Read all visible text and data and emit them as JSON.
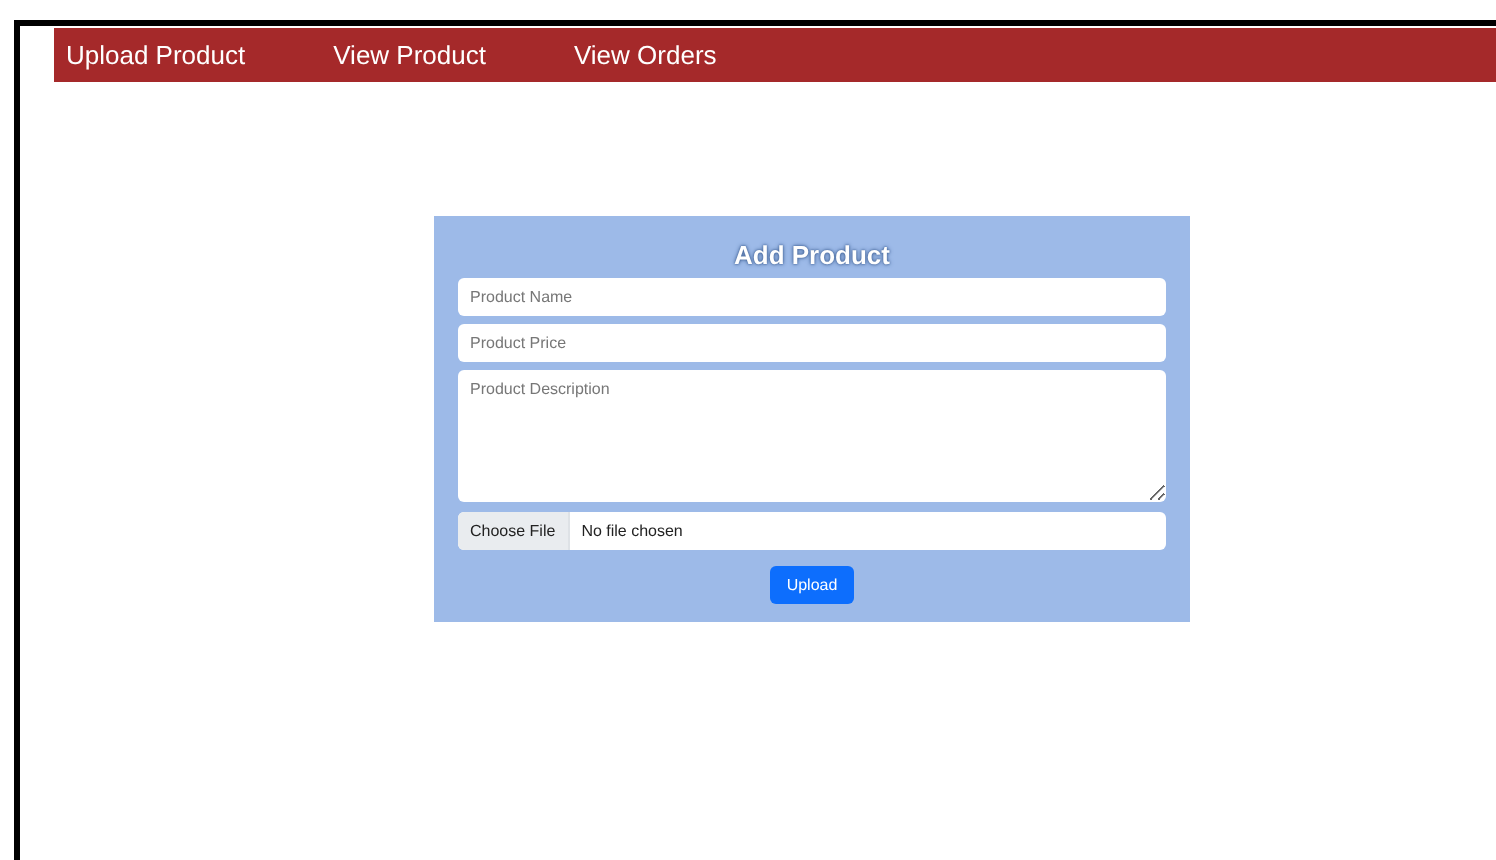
{
  "nav": {
    "items": [
      {
        "label": "Upload Product"
      },
      {
        "label": "View Product"
      },
      {
        "label": "View Orders"
      }
    ]
  },
  "form": {
    "title": "Add Product",
    "fields": [
      {
        "kind": "input",
        "placeholder": "Product Name"
      },
      {
        "kind": "input",
        "placeholder": "Product Price"
      },
      {
        "kind": "textarea",
        "placeholder": "Product Description"
      }
    ],
    "file": {
      "button": "Choose File",
      "status": "No file chosen"
    },
    "submit": "Upload"
  }
}
